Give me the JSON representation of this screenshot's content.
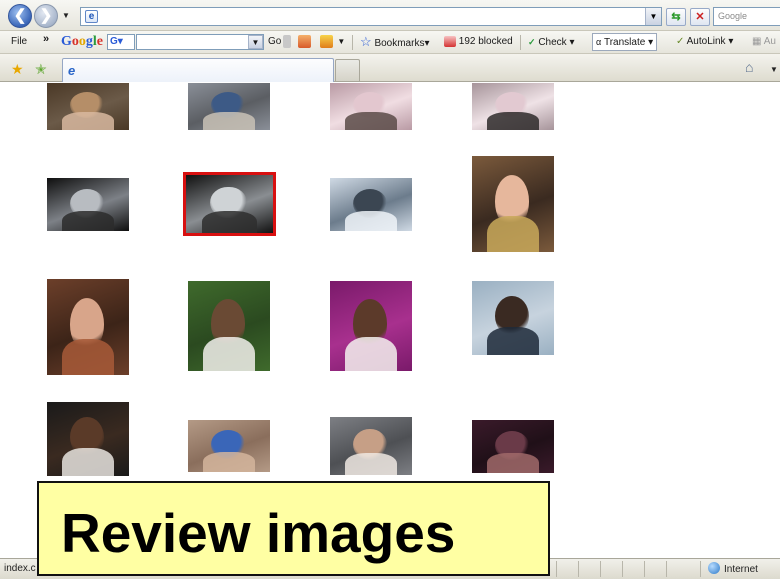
{
  "browser": {
    "address_value": "",
    "search_placeholder": "Google"
  },
  "toolbar": {
    "file_label": "File",
    "chevron_label": "»",
    "google_logo": [
      "G",
      "o",
      "o",
      "g",
      "l",
      "e"
    ],
    "google_g_label": "G▾",
    "go_label": "Go",
    "bookmarks_label": "Bookmarks▾",
    "blocked_label": "192 blocked",
    "check_label": "Check ▾",
    "translate_label": "Translate ▾",
    "autolink_label": "AutoLink ▾",
    "extra_label": "Au"
  },
  "status": {
    "text": "index.c",
    "zone_label": "Internet"
  },
  "caption": {
    "text": "Review images"
  },
  "photos": [
    {
      "name": "photo-family-living-room",
      "colors": [
        "#4a3826",
        "#b58e68",
        "#d8b9a0",
        "#6b5a48"
      ]
    },
    {
      "name": "photo-baby-on-couch",
      "colors": [
        "#8a8f98",
        "#3d5a86",
        "#c9c2b6",
        "#5b5e63"
      ]
    },
    {
      "name": "photo-baby-pink-blanket",
      "colors": [
        "#b99aa4",
        "#e3c7cf",
        "#5a4b48",
        "#f0dde2"
      ]
    },
    {
      "name": "photo-baby-with-puppy",
      "colors": [
        "#a6949a",
        "#e2c9d1",
        "#2e2a2a",
        "#efe2e6"
      ]
    },
    {
      "name": "photo-car-interior",
      "colors": [
        "#0f0f0f",
        "#b8bcc1",
        "#2b2b2b",
        "#7d8187"
      ]
    },
    {
      "name": "photo-car-window-selected",
      "colors": [
        "#111111",
        "#cfd3d6",
        "#2e2e2e",
        "#8a8e92"
      ]
    },
    {
      "name": "photo-snowy-street",
      "colors": [
        "#cfd9e4",
        "#3b4652",
        "#eef3f8",
        "#6c7c8c"
      ]
    },
    {
      "name": "photo-couple-selfie",
      "colors": [
        "#7b5a3c",
        "#e6b79c",
        "#c9a95a",
        "#3a2a20"
      ]
    },
    {
      "name": "photo-girl-long-hair",
      "colors": [
        "#6c3f2a",
        "#d8a58a",
        "#a85a38",
        "#3c2418"
      ]
    },
    {
      "name": "photo-girl-outdoors",
      "colors": [
        "#3f6a2c",
        "#6a4a34",
        "#f2f0ec",
        "#2b4a20"
      ]
    },
    {
      "name": "photo-portrait-magenta",
      "colors": [
        "#7a1a6a",
        "#5c3a2a",
        "#f4f1ef",
        "#a8308e"
      ]
    },
    {
      "name": "photo-portrait-blue",
      "colors": [
        "#9ab0c2",
        "#3a2a22",
        "#1e2a3a",
        "#c7d3de"
      ]
    },
    {
      "name": "photo-prom-couple",
      "colors": [
        "#1a1a1a",
        "#5a3a28",
        "#e8e4df",
        "#3a2a20"
      ]
    },
    {
      "name": "photo-toddler-on-floor",
      "colors": [
        "#b49a86",
        "#3a66b8",
        "#d4b59c",
        "#8a6e5c"
      ]
    },
    {
      "name": "photo-baby-closeup",
      "colors": [
        "#7d7f84",
        "#c69f86",
        "#efe8e2",
        "#4e5054"
      ]
    },
    {
      "name": "photo-woman-glasses",
      "colors": [
        "#3a1a2a",
        "#6a3a48",
        "#a06a6a",
        "#201018"
      ]
    }
  ]
}
